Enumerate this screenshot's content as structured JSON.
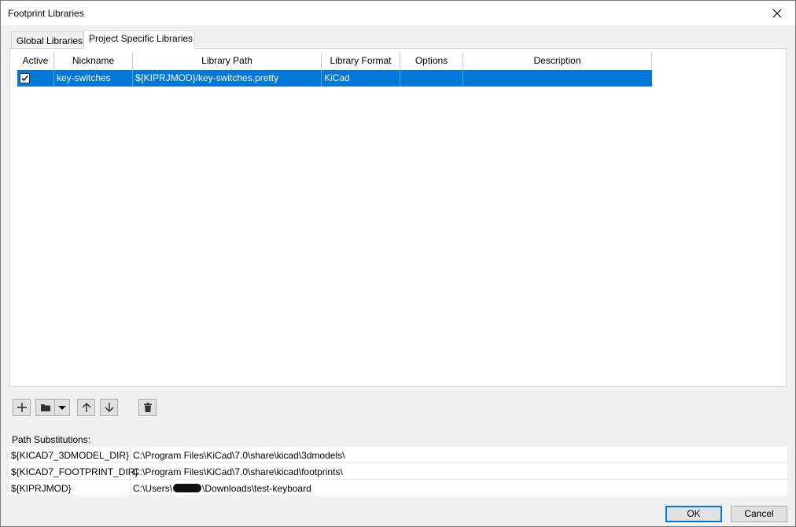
{
  "window": {
    "title": "Footprint Libraries",
    "close_icon": "close-icon"
  },
  "tabs": [
    {
      "label": "Global Libraries",
      "active": false
    },
    {
      "label": "Project Specific Libraries",
      "active": true
    }
  ],
  "library_table": {
    "columns": [
      "Active",
      "Nickname",
      "Library Path",
      "Library Format",
      "Options",
      "Description"
    ],
    "rows": [
      {
        "active": true,
        "nickname": "key-switches",
        "path": "${KIPRJMOD}/key-switches.pretty",
        "format": "KiCad",
        "options": "",
        "description": ""
      }
    ],
    "selection_color": "#0078d7"
  },
  "toolbar": {
    "buttons": [
      "add-icon",
      "folder-icon",
      "dropdown-arrow-icon",
      "arrow-up-icon",
      "arrow-down-icon",
      "trash-icon"
    ]
  },
  "path_substitutions": {
    "label": "Path Substitutions:",
    "rows": [
      {
        "name": "${KICAD7_3DMODEL_DIR}",
        "value": "C:\\Program Files\\KiCad\\7.0\\share\\kicad\\3dmodels\\"
      },
      {
        "name": "${KICAD7_FOOTPRINT_DIR}",
        "value": "C:\\Program Files\\KiCad\\7.0\\share\\kicad\\footprints\\"
      },
      {
        "name": "${KIPRJMOD}",
        "value_prefix": "C:\\Users\\",
        "value_suffix": "\\Downloads\\test-keyboard"
      }
    ]
  },
  "buttons": {
    "ok": "OK",
    "cancel": "Cancel"
  }
}
